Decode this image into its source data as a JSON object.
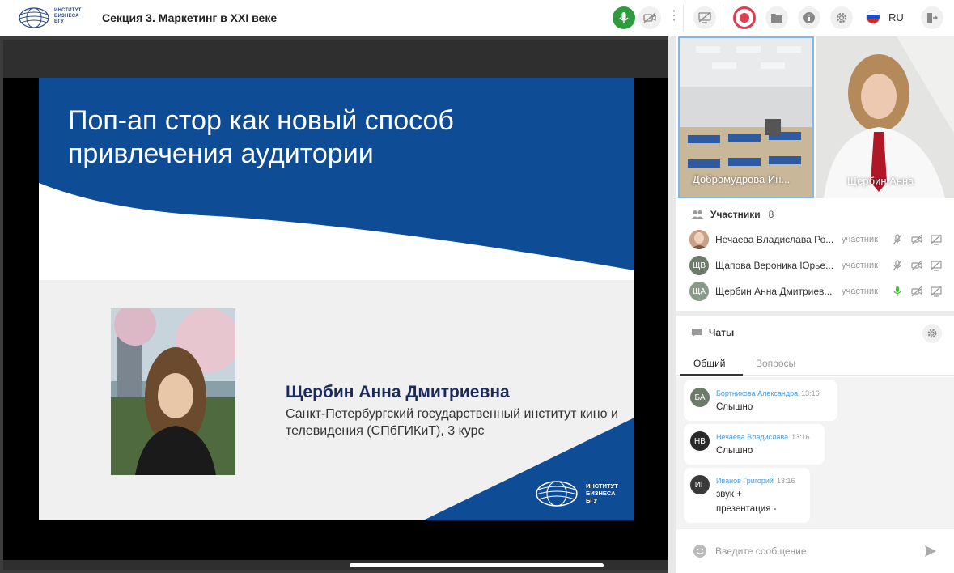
{
  "brand": {
    "logo_text": "ИНСТИТУТ\nБИЗНЕСА\nБГУ"
  },
  "header": {
    "title": "Секция 3. Маркетинг в XXI веке",
    "language": "RU"
  },
  "slide": {
    "title": "Поп-ап стор как новый способ\nпривлечения аудитории",
    "speaker_name": "Щербин Анна Дмитриевна",
    "speaker_org": "Санкт-Петербургский государственный институт кино и телевидения (СПбГИКиТ), 3 курс",
    "logo_text": "ИНСТИТУТ\nБИЗНЕСА\nБГУ"
  },
  "videos": [
    {
      "label": "Добромудрова Ин..."
    },
    {
      "label": "Щербин Анна"
    }
  ],
  "participants": {
    "title": "Участники",
    "count": "8",
    "items": [
      {
        "initials": "",
        "name": "Нечаева Владислава Ро...",
        "role": "участник",
        "mic": "muted"
      },
      {
        "initials": "ЩВ",
        "name": "Щапова Вероника Юрье...",
        "role": "участник",
        "mic": "muted"
      },
      {
        "initials": "ЩА",
        "name": "Щербин Анна Дмитриев...",
        "role": "участник",
        "mic": "on"
      }
    ]
  },
  "chats": {
    "title": "Чаты",
    "tabs": [
      {
        "label": "Общий"
      },
      {
        "label": "Вопросы"
      }
    ],
    "messages": [
      {
        "initials": "БА",
        "author": "Бортникова Александра",
        "time": "13:16",
        "text": "Слышно"
      },
      {
        "initials": "НВ",
        "author": "Нечаева Владислава",
        "time": "13:16",
        "text": "Слышно"
      },
      {
        "initials": "ИГ",
        "author": "Иванов Григорий",
        "time": "13:16",
        "text": "звук +\nпрезентация -"
      }
    ],
    "input_placeholder": "Введите сообщение"
  },
  "colors": {
    "accent_green": "#2e9c3c",
    "record_red": "#e23b4e",
    "slide_blue": "#0f4c96",
    "link_blue": "#4a9ad4"
  }
}
